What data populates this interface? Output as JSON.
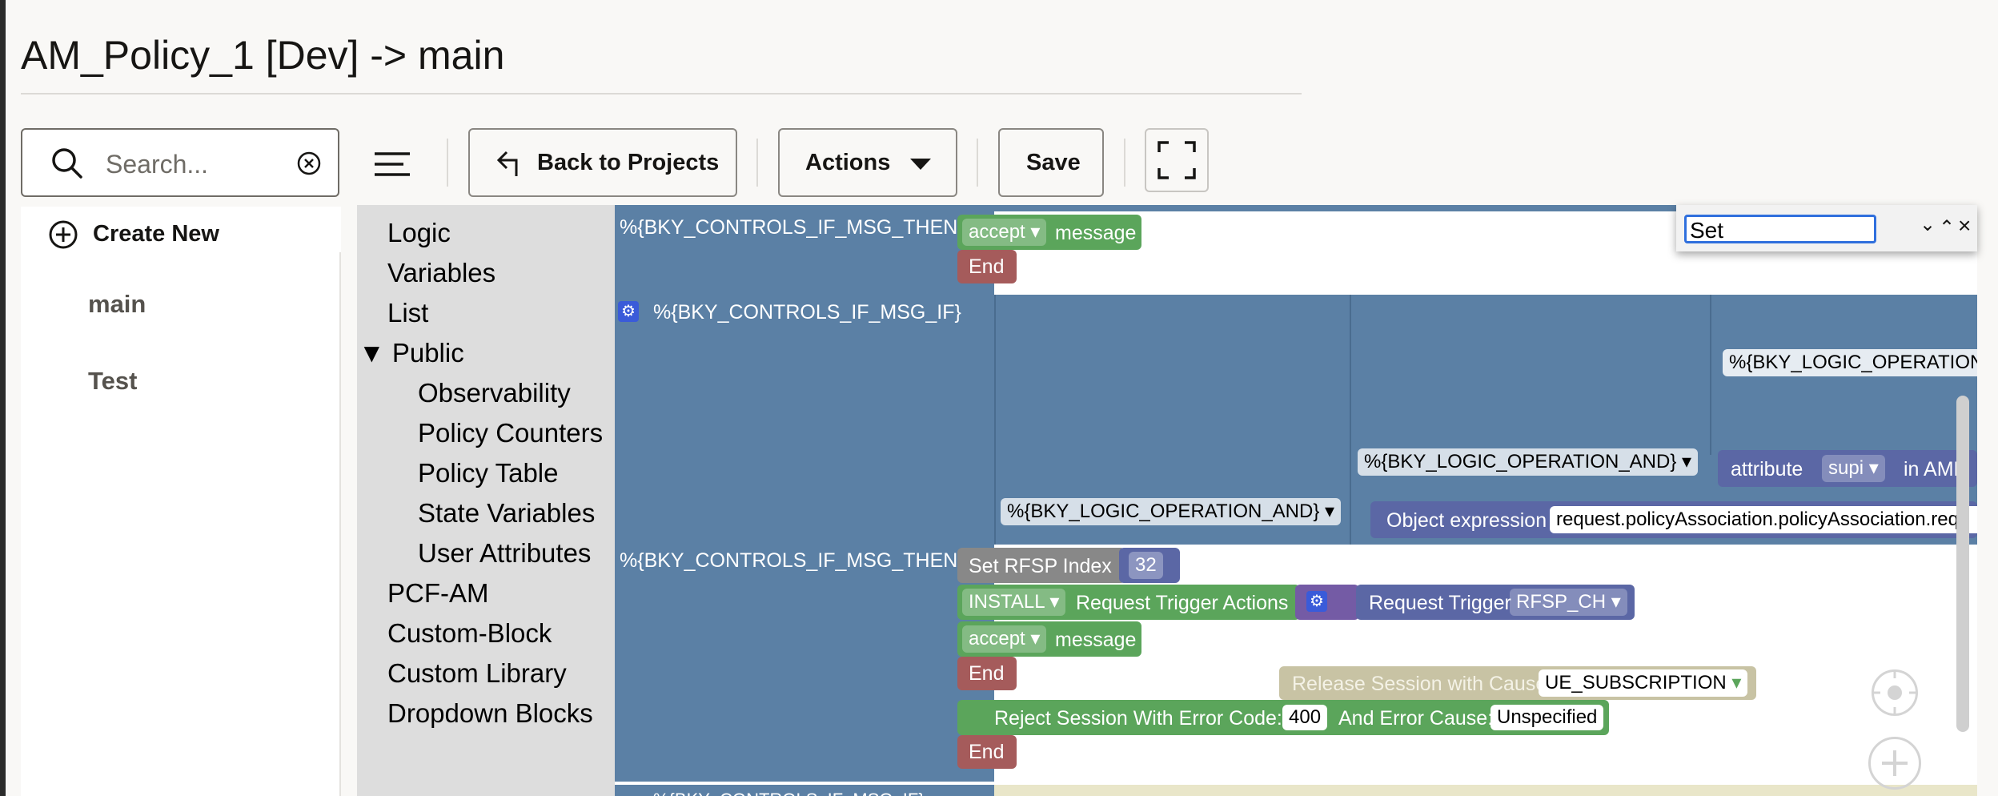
{
  "page": {
    "title": "AM_Policy_1 [Dev] -> main"
  },
  "toolbar": {
    "search_placeholder": "Search...",
    "back_label": "Back to Projects",
    "actions_label": "Actions",
    "save_label": "Save"
  },
  "sidebar": {
    "create_label": "Create New",
    "items": [
      "main",
      "Test"
    ]
  },
  "toolbox": {
    "categories": [
      "Logic",
      "Variables",
      "List"
    ],
    "public_label": "Public",
    "public_items": [
      "Observability",
      "Policy Counters",
      "Policy Table",
      "State Variables",
      "User Attributes"
    ],
    "more_categories": [
      "PCF-AM",
      "Custom-Block",
      "Custom Library",
      "Dropdown Blocks"
    ]
  },
  "find": {
    "value": "Set"
  },
  "canvas": {
    "then_msg": "%{BKY_CONTROLS_IF_MSG_THEN}",
    "if_msg": "%{BKY_CONTROLS_IF_MSG_IF}",
    "then_msg_2": "%{BKY_CONTROLS_IF_MSG_THEN}",
    "accept_label": "accept",
    "message_label": "message",
    "end_label": "End",
    "logic_op_or": "%{BKY_LOGIC_OPERATION",
    "logic_op_and_1": "%{BKY_LOGIC_OPERATION_AND}",
    "logic_op_and_2": "%{BKY_LOGIC_OPERATION_AND}",
    "attribute_label": "attribute",
    "attribute_value": "supi",
    "attribute_in": "in AMF",
    "object_expr_label": "Object expression",
    "object_expr_value": "request.policyAssociation.policyAssociation.requ",
    "set_rfsp_label": "Set RFSP Index",
    "set_rfsp_value": "32",
    "install_label": "INSTALL",
    "request_trigger_actions": "Request Trigger Actions",
    "request_trigger_label": "Request Trigger",
    "request_trigger_value": "RFSP_CH",
    "accept_label_2": "accept",
    "message_label_2": "message",
    "end_label_2": "End",
    "release_label": "Release Session with Cause:",
    "release_value": "UE_SUBSCRIPTION",
    "reject_label": "Reject Session With Error Code:",
    "reject_code": "400",
    "reject_cause_label": "And Error Cause:",
    "reject_cause_value": "Unspecified",
    "end_label_3": "End",
    "partial_bottom": "%{BKY_CONTROLS_IF_MSG_IF}"
  },
  "colors": {
    "block_blue": "#5b80a5",
    "block_green": "#5ba55b",
    "block_red": "#a55b5b",
    "block_purple": "#5b67a5",
    "find_border": "#2f6fdd"
  }
}
